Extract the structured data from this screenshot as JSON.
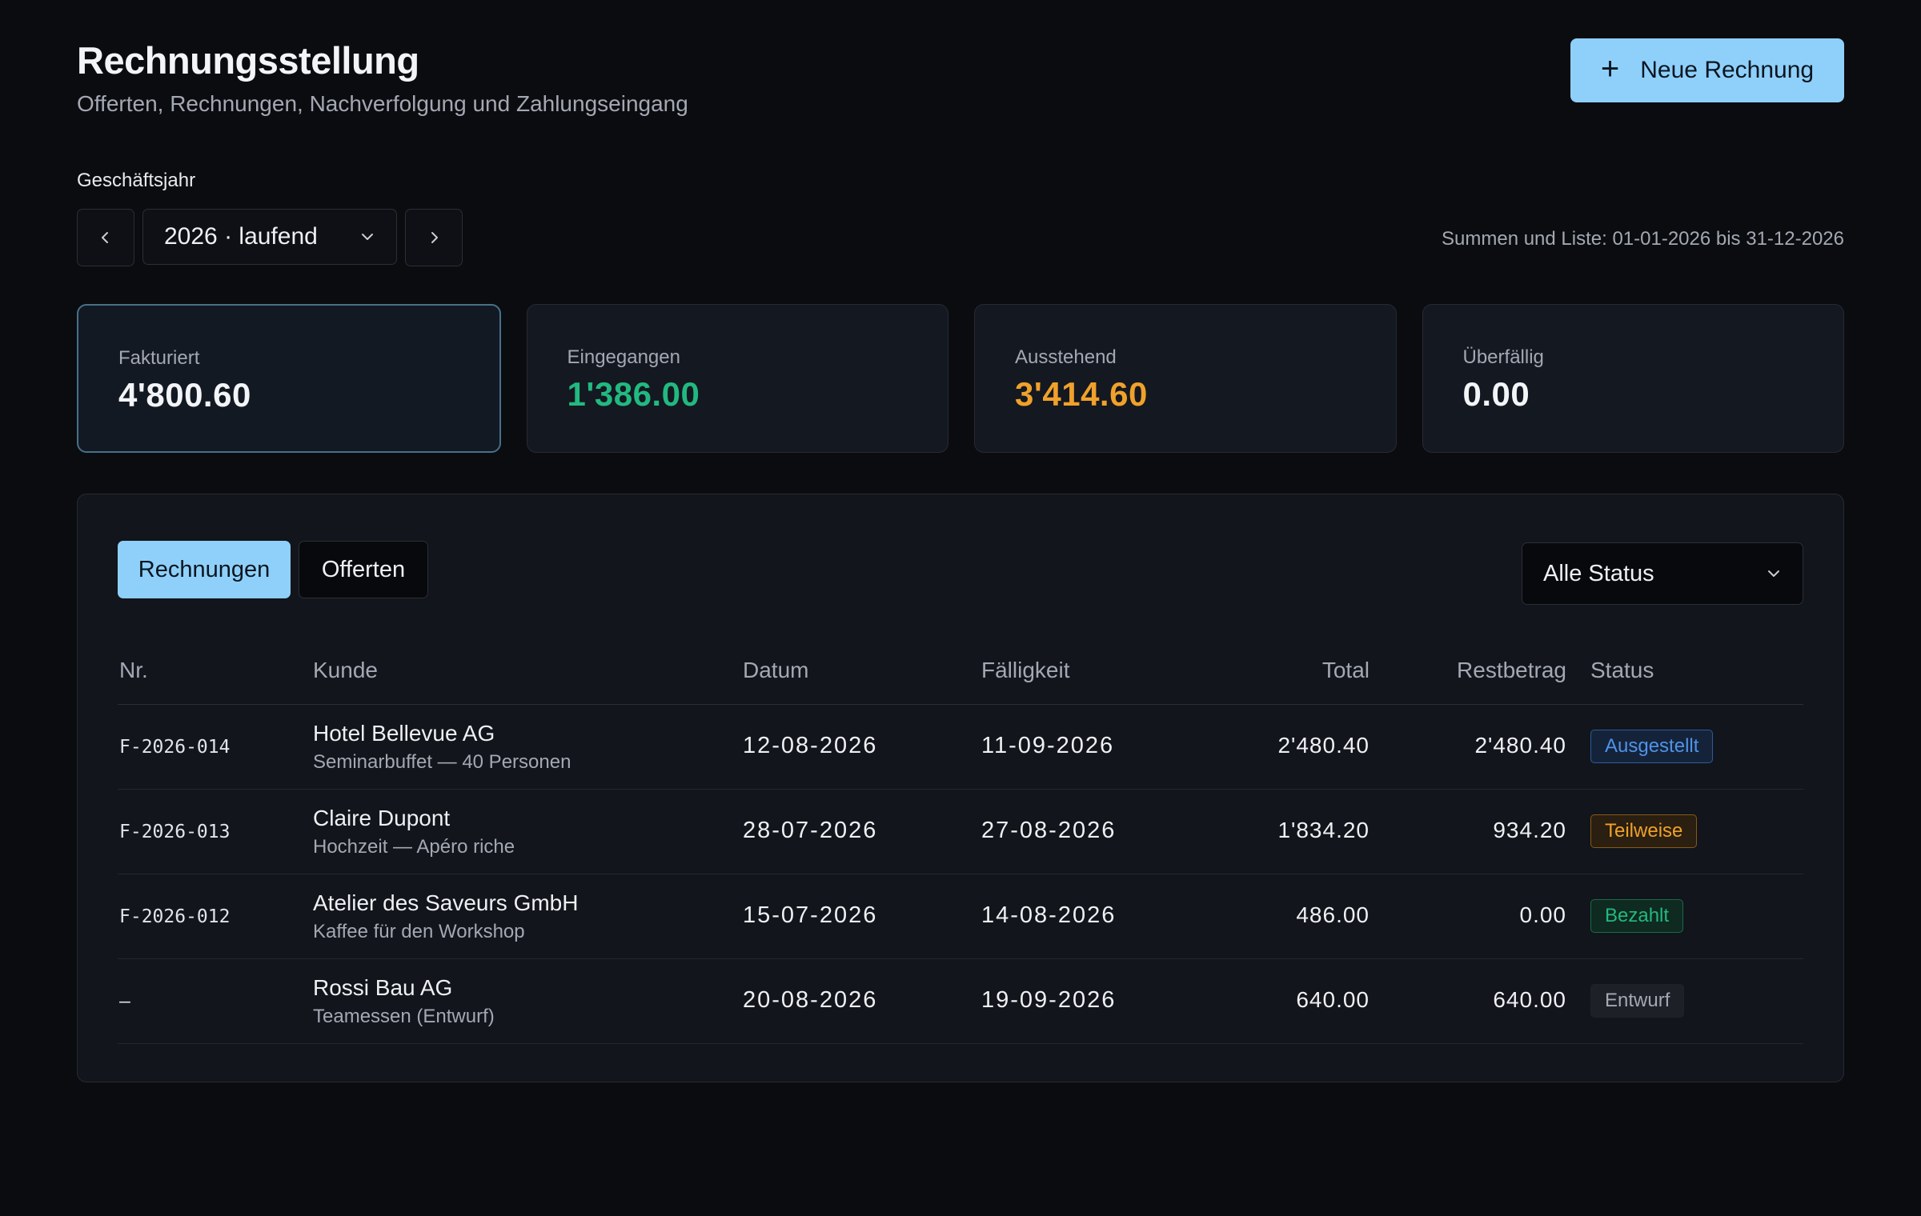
{
  "header": {
    "title": "Rechnungsstellung",
    "subtitle": "Offerten, Rechnungen, Nachverfolgung und Zahlungseingang",
    "new_button_icon": "plus-icon",
    "new_button_label": "Neue Rechnung"
  },
  "fiscal_year": {
    "label": "Geschäftsjahr",
    "selected": "2026 · laufend",
    "range_text": "Summen und Liste: 01-01-2026 bis 31-12-2026"
  },
  "kpis": [
    {
      "label": "Fakturiert",
      "value": "4'800.60",
      "color": "#f2f4f7"
    },
    {
      "label": "Eingegangen",
      "value": "1'386.00",
      "color": "#22b980"
    },
    {
      "label": "Ausstehend",
      "value": "3'414.60",
      "color": "#f0a12b"
    },
    {
      "label": "Überfällig",
      "value": "0.00",
      "color": "#f2f4f7"
    }
  ],
  "tabs": [
    {
      "label": "Rechnungen",
      "active": true
    },
    {
      "label": "Offerten",
      "active": false
    }
  ],
  "status_filter": {
    "selected": "Alle Status"
  },
  "table": {
    "columns": [
      "Nr.",
      "Kunde",
      "Datum",
      "Fälligkeit",
      "Total",
      "Restbetrag",
      "Status"
    ],
    "rows": [
      {
        "nr": "F-2026-014",
        "kunde": "Hotel Bellevue AG",
        "beschreibung": "Seminarbuffet — 40 Personen",
        "datum": "12-08-2026",
        "faelligkeit": "11-09-2026",
        "total": "2'480.40",
        "rest": "2'480.40",
        "status": "Ausgestellt",
        "status_color": "#4f93e8"
      },
      {
        "nr": "F-2026-013",
        "kunde": "Claire Dupont",
        "beschreibung": "Hochzeit — Apéro riche",
        "datum": "28-07-2026",
        "faelligkeit": "27-08-2026",
        "total": "1'834.20",
        "rest": "934.20",
        "status": "Teilweise",
        "status_color": "#f0a12b"
      },
      {
        "nr": "F-2026-012",
        "kunde": "Atelier des Saveurs GmbH",
        "beschreibung": "Kaffee für den Workshop",
        "datum": "15-07-2026",
        "faelligkeit": "14-08-2026",
        "total": "486.00",
        "rest": "0.00",
        "status": "Bezahlt",
        "status_color": "#22b980"
      },
      {
        "nr": "–",
        "kunde": "Rossi Bau AG",
        "beschreibung": "Teamessen (Entwurf)",
        "datum": "20-08-2026",
        "faelligkeit": "19-09-2026",
        "total": "640.00",
        "rest": "640.00",
        "status": "Entwurf",
        "status_color": "#a3a8b3"
      }
    ]
  }
}
